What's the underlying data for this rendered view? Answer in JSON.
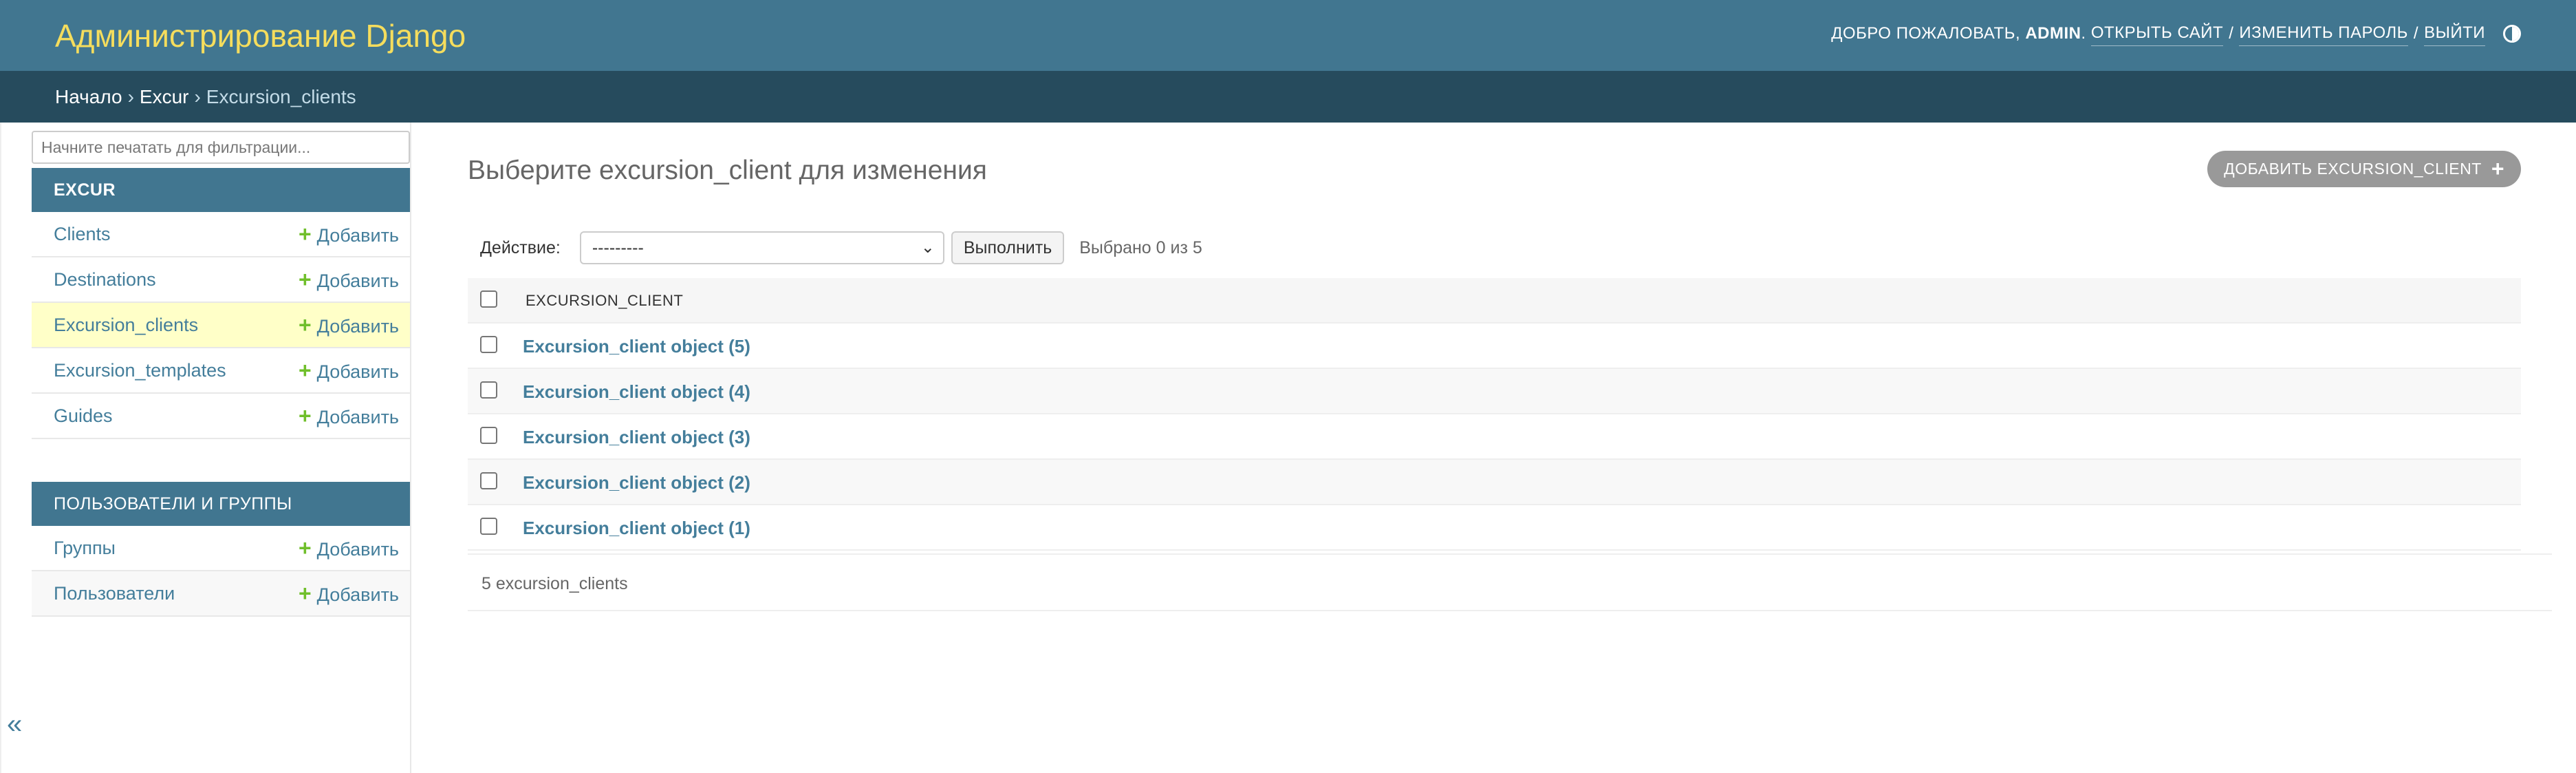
{
  "header": {
    "site_name": "Администрирование Django",
    "welcome": "ДОБРО ПОЖАЛОВАТЬ,",
    "username": "ADMIN",
    "after_user": ".",
    "view_site": "ОТКРЫТЬ САЙТ",
    "change_password": "ИЗМЕНИТЬ ПАРОЛЬ",
    "logout": "ВЫЙТИ",
    "separator": "/",
    "theme_icon": "theme-toggle-icon"
  },
  "breadcrumbs": {
    "home": "Начало",
    "app": "Excur",
    "current": "Excursion_clients",
    "separator": "›"
  },
  "sidebar": {
    "filter_placeholder": "Начните печатать для фильтрации...",
    "add_label": "Добавить",
    "apps": [
      {
        "caption": "EXCUR",
        "models": [
          "Clients",
          "Destinations",
          "Excursion_clients",
          "Excursion_templates",
          "Guides"
        ],
        "current": "Excursion_clients"
      },
      {
        "caption": "ПОЛЬЗОВАТЕЛИ И ГРУППЫ",
        "models": [
          "Группы",
          "Пользователи"
        ]
      }
    ],
    "toggle_label": "«"
  },
  "content": {
    "title": "Выберите excursion_client для изменения",
    "add_button": "ДОБАВИТЬ EXCURSION_CLIENT",
    "add_button_icon": "+",
    "actions": {
      "label": "Действие:",
      "selected": "---------",
      "run": "Выполнить",
      "counter": "Выбрано 0 из 5"
    },
    "table": {
      "column": "EXCURSION_CLIENT",
      "rows": [
        "Excursion_client object (5)",
        "Excursion_client object (4)",
        "Excursion_client object (3)",
        "Excursion_client object (2)",
        "Excursion_client object (1)"
      ]
    },
    "paginator": "5 excursion_clients"
  },
  "colors": {
    "header_bg": "#417690",
    "breadcrumb_bg": "#264b5d",
    "site_name": "#f5dd5d",
    "link": "#447e9b",
    "add_plus": "#70bf2b",
    "current_row": "#ffffc8",
    "button_bg": "#999999"
  }
}
